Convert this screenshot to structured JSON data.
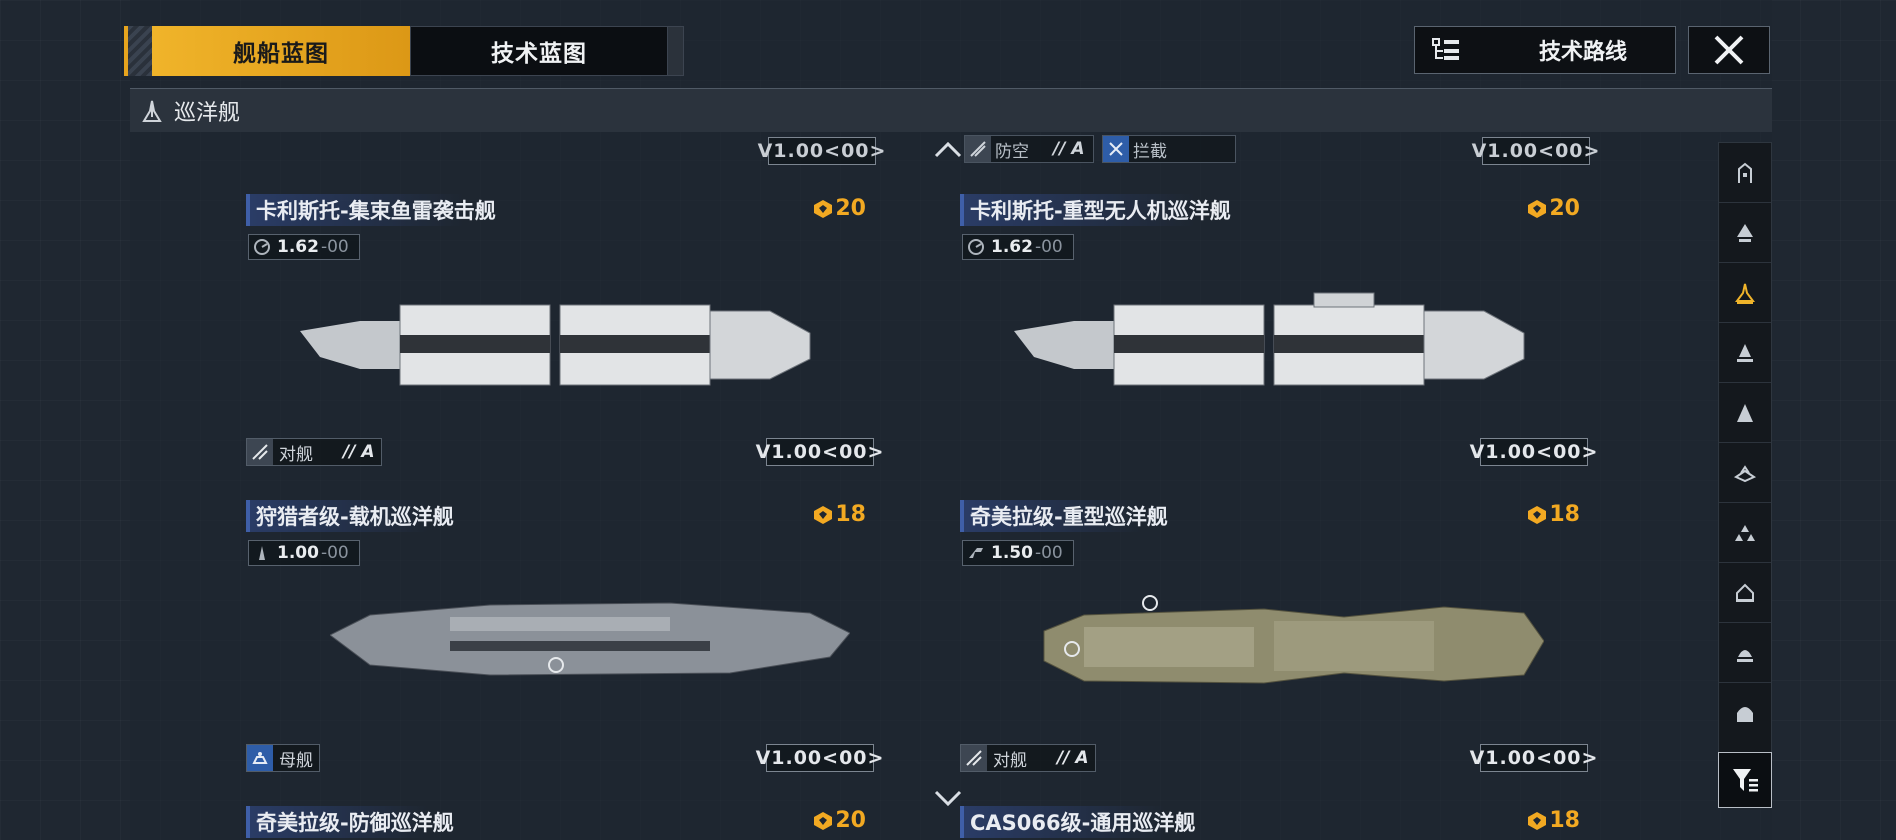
{
  "tabs": [
    {
      "label": "舰船蓝图",
      "active": true
    },
    {
      "label": "技术蓝图",
      "active": false
    }
  ],
  "route_button": {
    "label": "技术路线",
    "icon": "tech-tree-icon"
  },
  "close_button": {
    "icon": "close-icon"
  },
  "section": {
    "title": "巡洋舰",
    "icon": "cruiser-icon"
  },
  "top_row": {
    "left_version": "V1.00<00>",
    "right_roles": [
      {
        "label": "防空",
        "grade": "// A",
        "icon": "anti-air-icon"
      },
      {
        "label": "拦截",
        "grade": "",
        "icon": "intercept-icon"
      }
    ],
    "right_version": "V1.00<00>"
  },
  "cards": [
    {
      "title": "卡利斯托-集束鱼雷袭击舰",
      "cost": "20",
      "speed": "1.62",
      "speed_suffix": "-00",
      "role": "对舰",
      "grade": "// A",
      "version": "V1.00<00>",
      "role_icon": "anti-ship-icon"
    },
    {
      "title": "卡利斯托-重型无人机巡洋舰",
      "cost": "20",
      "speed": "1.62",
      "speed_suffix": "-00",
      "role": "",
      "grade": "",
      "version": "V1.00<00>",
      "role_icon": ""
    },
    {
      "title": "狩猎者级-载机巡洋舰",
      "cost": "18",
      "speed": "1.00",
      "speed_suffix": "-00",
      "role": "母舰",
      "grade": "",
      "version": "V1.00<00>",
      "role_icon": "carrier-icon"
    },
    {
      "title": "奇美拉级-重型巡洋舰",
      "cost": "18",
      "speed": "1.50",
      "speed_suffix": "-00",
      "role": "对舰",
      "grade": "// A",
      "version": "V1.00<00>",
      "role_icon": "anti-ship-icon"
    }
  ],
  "bottom_row": [
    {
      "title": "奇美拉级-防御巡洋舰",
      "cost": "20"
    },
    {
      "title": "CAS066级-通用巡洋舰",
      "cost": "18"
    }
  ],
  "sidebar_icons": [
    "frigate-icon",
    "destroyer-icon",
    "cruiser-icon",
    "battlecruiser-icon",
    "battleship-icon",
    "carrier-icon",
    "support-icon",
    "station-icon",
    "outpost-icon",
    "base-icon"
  ],
  "sidebar_active_index": 2,
  "colors": {
    "accent": "#f0b42a",
    "title_bar": "#2a3c66",
    "cost": "#f2a922",
    "background": "#1f2731"
  }
}
